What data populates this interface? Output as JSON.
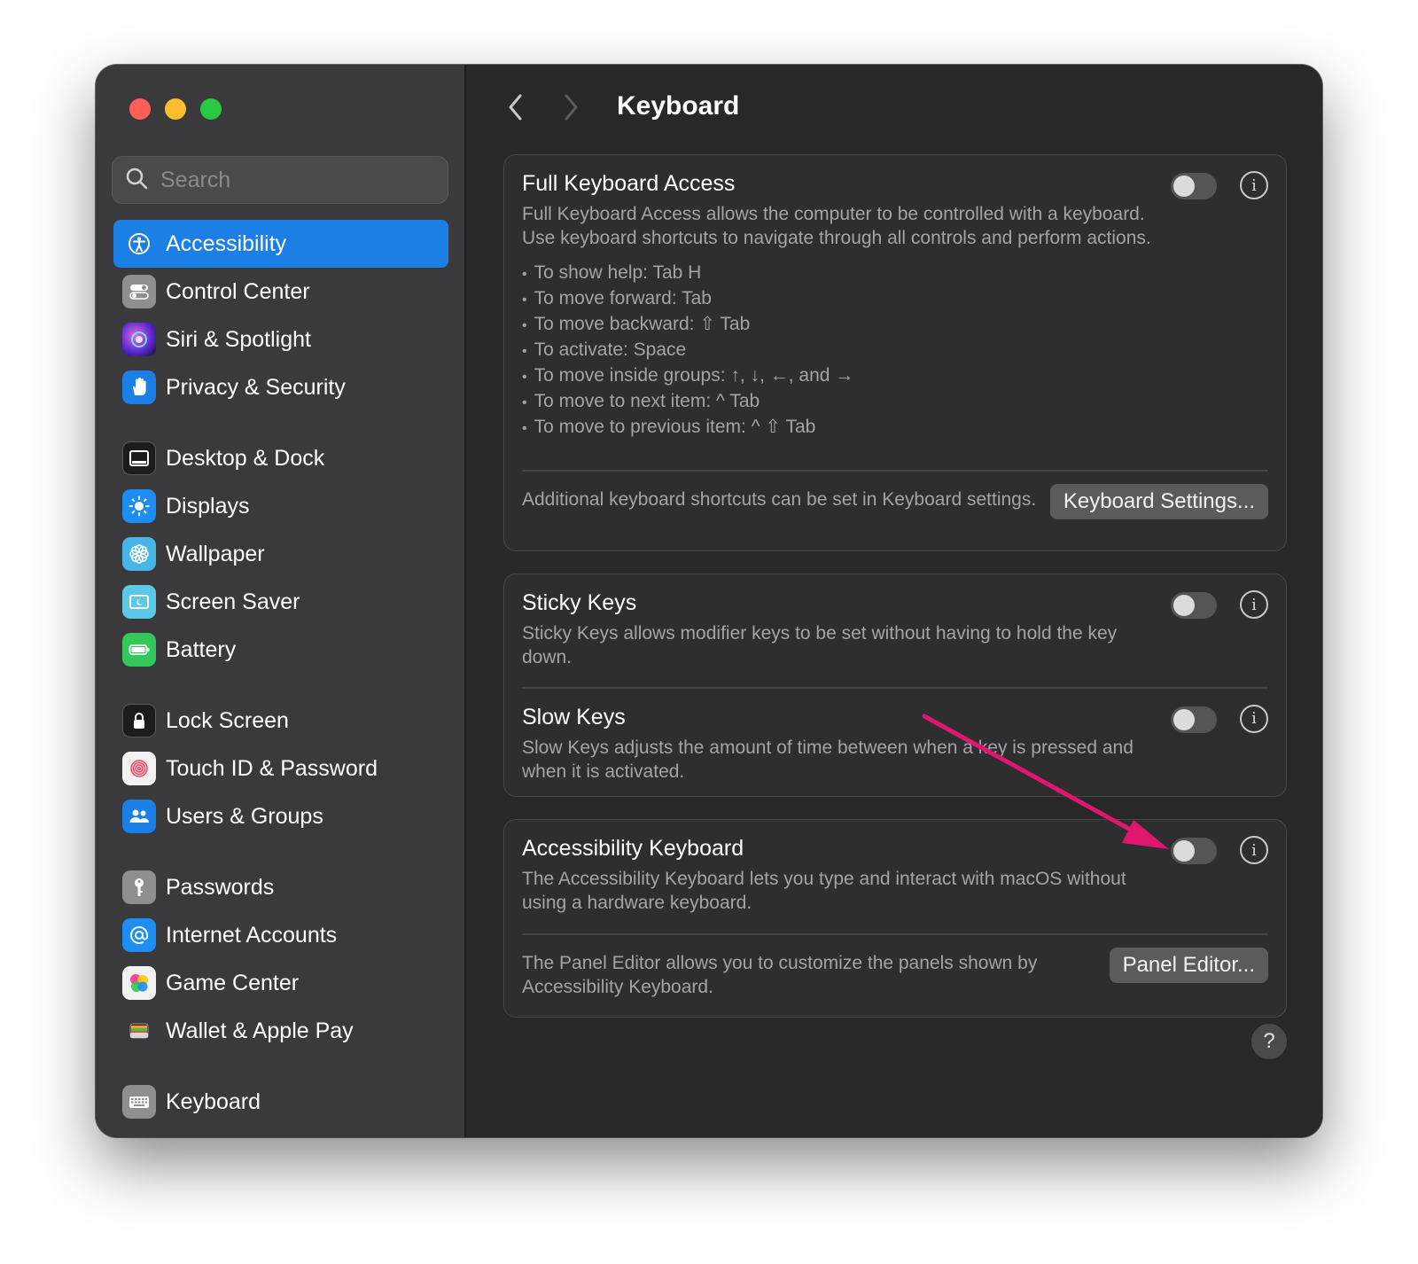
{
  "search": {
    "placeholder": "Search"
  },
  "sidebar": {
    "items": [
      {
        "label": "Accessibility",
        "icon": "accessibility-icon",
        "color": "#1c7fe6",
        "active": true
      },
      {
        "label": "Control Center",
        "icon": "control-center-icon",
        "color": "#8e8e93"
      },
      {
        "label": "Siri & Spotlight",
        "icon": "siri-icon",
        "color": "#9b3fd9"
      },
      {
        "label": "Privacy & Security",
        "icon": "hand-icon",
        "color": "#1c7fe6"
      },
      {
        "label": "Desktop & Dock",
        "icon": "dock-icon",
        "color": "#1c1c1e"
      },
      {
        "label": "Displays",
        "icon": "sun-icon",
        "color": "#1c8ef5"
      },
      {
        "label": "Wallpaper",
        "icon": "flower-icon",
        "color": "#47b5e6"
      },
      {
        "label": "Screen Saver",
        "icon": "screen-saver-icon",
        "color": "#5ac8e6"
      },
      {
        "label": "Battery",
        "icon": "battery-icon",
        "color": "#34c759"
      },
      {
        "label": "Lock Screen",
        "icon": "lock-icon",
        "color": "#1c1c1e"
      },
      {
        "label": "Touch ID & Password",
        "icon": "fingerprint-icon",
        "color": "#f2f2f2"
      },
      {
        "label": "Users & Groups",
        "icon": "users-icon",
        "color": "#1c7fe6"
      },
      {
        "label": "Passwords",
        "icon": "key-icon",
        "color": "#8e8e93"
      },
      {
        "label": "Internet Accounts",
        "icon": "at-icon",
        "color": "#1c8ef5"
      },
      {
        "label": "Game Center",
        "icon": "game-center-icon",
        "color": "#f2f2f2"
      },
      {
        "label": "Wallet & Apple Pay",
        "icon": "wallet-icon",
        "color": "#3a3a3c"
      },
      {
        "label": "Keyboard",
        "icon": "keyboard-icon",
        "color": "#8e8e93"
      }
    ]
  },
  "header": {
    "title": "Keyboard"
  },
  "full_keyboard_access": {
    "title": "Full Keyboard Access",
    "description": "Full Keyboard Access allows the computer to be controlled with a keyboard. Use keyboard shortcuts to navigate through all controls and perform actions.",
    "enabled": false,
    "bullets": [
      "To show help: Tab H",
      "To move forward: Tab",
      "To move backward: ⇧ Tab",
      "To activate: Space",
      "To move inside groups: ↑, ↓, ←, and →",
      "To move to next item: ^ Tab",
      "To move to previous item: ^ ⇧ Tab"
    ],
    "footer_text": "Additional keyboard shortcuts can be set in Keyboard settings.",
    "button_label": "Keyboard Settings..."
  },
  "sticky_keys": {
    "title": "Sticky Keys",
    "description": "Sticky Keys allows modifier keys to be set without having to hold the key down.",
    "enabled": false
  },
  "slow_keys": {
    "title": "Slow Keys",
    "description": "Slow Keys adjusts the amount of time between when a key is pressed and when it is activated.",
    "enabled": false
  },
  "accessibility_keyboard": {
    "title": "Accessibility Keyboard",
    "description": "The Accessibility Keyboard lets you type and interact with macOS without using a hardware keyboard.",
    "enabled": false,
    "footer_text": "The Panel Editor allows you to customize the panels shown by Accessibility Keyboard.",
    "button_label": "Panel Editor..."
  },
  "info_glyph": "i",
  "help_glyph": "?",
  "annotation": {
    "arrow_color": "#e0176f"
  }
}
